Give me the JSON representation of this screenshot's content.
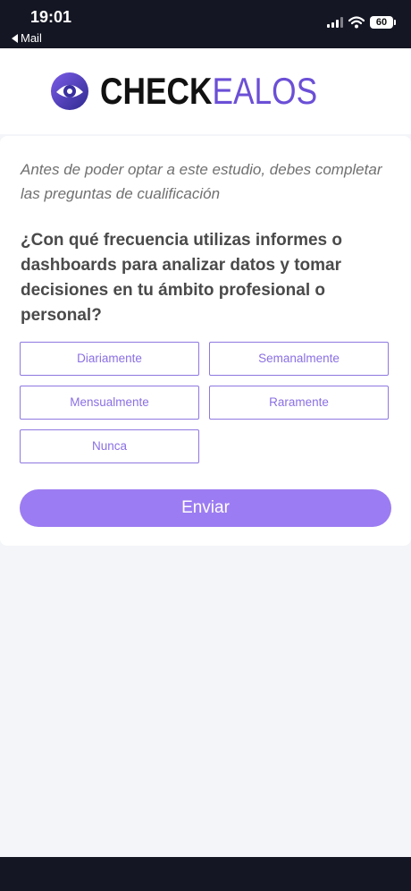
{
  "status_bar": {
    "time": "19:01",
    "back_app": "Mail",
    "battery": "60"
  },
  "header": {
    "logo_bold": "CHECK",
    "logo_light": "EALOS",
    "brand_color": "#6b4fd6"
  },
  "survey": {
    "intro": "Antes de poder optar a este estudio, debes completar las preguntas de cualificación",
    "question": "¿Con qué frecuencia utilizas informes o dashboards para analizar datos y tomar decisiones en tu ámbito profesional o personal?",
    "options": [
      "Diariamente",
      "Semanalmente",
      "Mensualmente",
      "Raramente",
      "Nunca"
    ],
    "submit_label": "Enviar",
    "accent_color": "#9c7cf2"
  }
}
